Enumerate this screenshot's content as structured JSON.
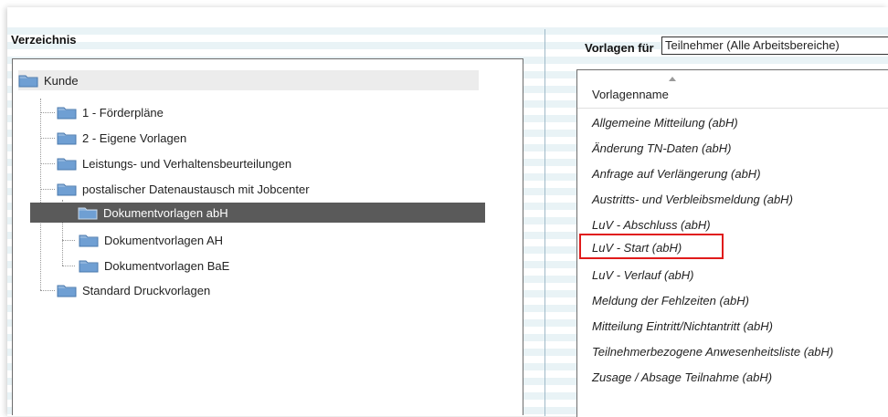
{
  "directory": {
    "heading": "Verzeichnis",
    "tree": [
      {
        "label": "Kunde"
      },
      {
        "label": "1 - Förderpläne"
      },
      {
        "label": "2 - Eigene Vorlagen"
      },
      {
        "label": "Leistungs- und Verhaltensbeurteilungen"
      },
      {
        "label": "postalischer Datenaustausch mit Jobcenter"
      },
      {
        "label": "Dokumentvorlagen abH",
        "selected": true
      },
      {
        "label": "Dokumentvorlagen AH"
      },
      {
        "label": "Dokumentvorlagen BaE"
      },
      {
        "label": "Standard Druckvorlagen"
      }
    ]
  },
  "templates": {
    "heading": "Vorlagen für",
    "filter_value": "Teilnehmer (Alle Arbeitsbereiche)",
    "column_header": "Vorlagenname",
    "items": [
      "Allgemeine Mitteilung (abH)",
      "Änderung TN-Daten (abH)",
      "Anfrage auf Verlängerung (abH)",
      "Austritts- und Verbleibsmeldung (abH)",
      "LuV - Abschluss (abH)",
      "LuV - Start (abH)",
      "LuV - Verlauf (abH)",
      "Meldung der Fehlzeiten (abH)",
      "Mitteilung Eintritt/Nichtantritt (abH)",
      "Teilnehmerbezogene Anwesenheitsliste (abH)",
      "Zusage / Absage Teilnahme (abH)"
    ],
    "highlighted_item": "LuV - Start (abH)"
  },
  "colors": {
    "selection_bg": "#5a5a5a",
    "highlight_border": "#e01b1b",
    "folder_blue": "#5b8fc9"
  },
  "icons": [
    "folder-icon",
    "sort-ascending-icon"
  ]
}
